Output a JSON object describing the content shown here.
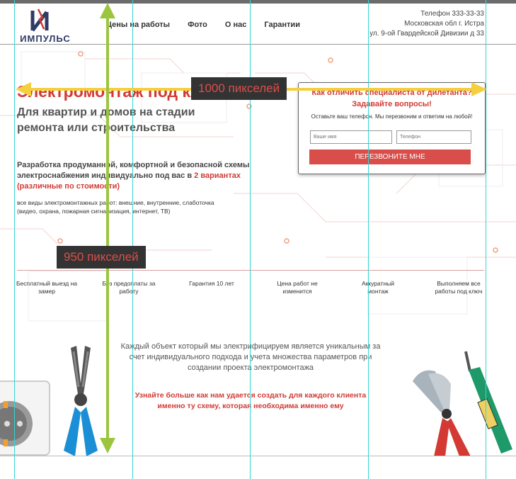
{
  "header": {
    "logo_text": "ИМПУЛЬС",
    "nav": [
      "Цены на работы",
      "Фото",
      "О нас",
      "Гарантии"
    ],
    "phone": "Телефон 333-33-33",
    "address_line1": "Московская обл г. Истра",
    "address_line2": "ул. 9-ой Гвардейской Дивизии д 33"
  },
  "hero": {
    "title": "Электромонтаж под ключ",
    "subtitle": "Для квартир и домов на стадии ремонта или строительства",
    "desc_part1": "Разработка продуманной, комфортной и безопасной схемы электроснабжения индивидуально под вас в ",
    "desc_red": "2 вариантах (различные по стоимости)",
    "small": "все виды электромонтажных работ: внешние, внутренние, слаботочка (видео, охрана, пожарная сигнализация, интернет, ТВ)"
  },
  "form": {
    "question1": "Как отличить специалиста от дилетанта?",
    "question2": "Задавайте вопросы!",
    "note": "Оставьте ваш телефон. Мы перезвоним и ответим на любой!",
    "name_placeholder": "Ваше имя",
    "phone_placeholder": "Телефон",
    "button": "ПЕРЕЗВОНИТЕ МНЕ"
  },
  "features": [
    "Бесплатный выезд на замер",
    "Без предоплаты за работу",
    "Гарантия 10 лет",
    "Цена работ не изменится",
    "Аккуратный монтаж",
    "Выполняем все работы под ключ"
  ],
  "info": {
    "text": "Каждый объект который мы электрифицируем является уникальным за счет индивидуального подхода и учета множества параметров при создании проекта электромонтажа",
    "red": "Узнайте больше как нам удается создать для каждого клиента именно ту схему, которая необходима именно ему"
  },
  "annotations": {
    "width_label": "1000 пикселей",
    "height_label": "950 пикселей"
  },
  "colors": {
    "accent_red": "#d23a33",
    "arrow_yellow": "#f4d03f",
    "arrow_green": "#9bc53d",
    "guide_cyan": "#33d6d6"
  }
}
